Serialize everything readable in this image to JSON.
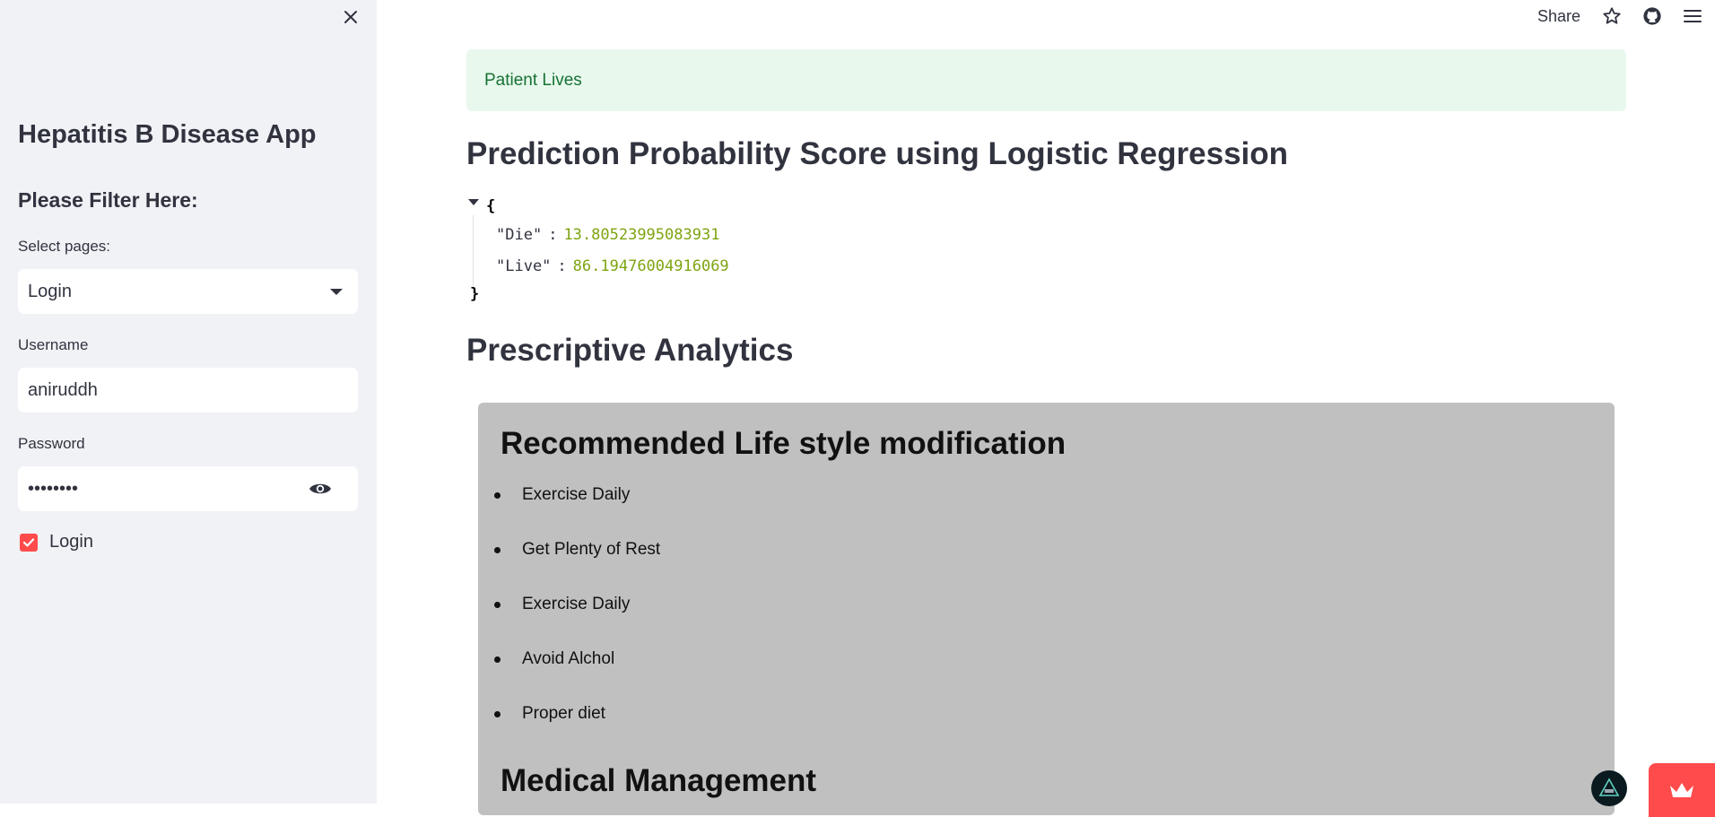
{
  "sidebar": {
    "title": "Hepatitis B Disease App",
    "subtitle": "Please Filter Here:",
    "select_label": "Select pages:",
    "select_value": "Login",
    "username_label": "Username",
    "username_value": "aniruddh",
    "password_label": "Password",
    "password_masked": "••••••••",
    "checkbox_label": "Login",
    "checkbox_checked": true
  },
  "toolbar": {
    "share_label": "Share",
    "icons": [
      "star-icon",
      "github-icon",
      "hamburger-menu-icon"
    ]
  },
  "main": {
    "alert_text": "Patient Lives",
    "prediction_heading": "Prediction Probability Score using Logistic Regression",
    "json_open": "{",
    "json_close": "}",
    "json_entries": [
      {
        "key": "\"Die\"",
        "value": "13.80523995083931"
      },
      {
        "key": "\"Live\"",
        "value": "86.19476004916069"
      }
    ],
    "prescriptive_heading": "Prescriptive Analytics",
    "panel": {
      "lifestyle_heading": "Recommended Life style modification",
      "lifestyle_items": [
        "Exercise Daily",
        "Get Plenty of Rest",
        "Exercise Daily",
        "Avoid Alchol",
        "Proper diet"
      ],
      "medical_heading": "Medical Management"
    }
  },
  "colors": {
    "primary": "#ff4b4b",
    "sidebar_bg": "#f0f2f6",
    "success_bg": "#e8f8ed",
    "success_text": "#177233",
    "panel_bg": "#c0c0c0",
    "json_number": "#7ea411"
  }
}
